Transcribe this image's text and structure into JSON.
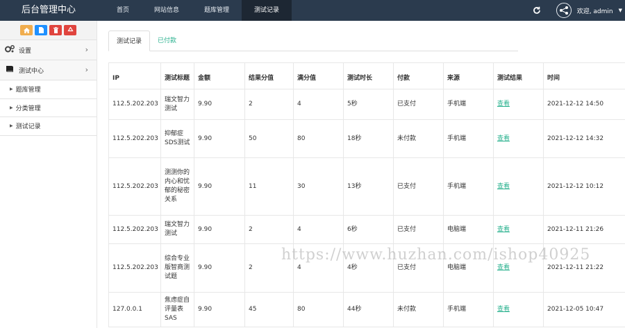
{
  "app": {
    "title": "后台管理中心"
  },
  "nav": [
    {
      "label": "首页",
      "active": false
    },
    {
      "label": "网站信息",
      "active": false
    },
    {
      "label": "题库管理",
      "active": false
    },
    {
      "label": "测试记录",
      "active": true
    }
  ],
  "user": {
    "welcome": "欢迎, admin"
  },
  "quick_buttons": [
    {
      "icon": "home-icon",
      "color": "#f0ad4e"
    },
    {
      "icon": "file-icon",
      "color": "#1e90ff"
    },
    {
      "icon": "trash-icon",
      "color": "#e0443e"
    },
    {
      "icon": "recycle-icon",
      "color": "#e0443e"
    }
  ],
  "sidebar": {
    "groups": [
      {
        "label": "设置",
        "icon": "gears-icon"
      },
      {
        "label": "测试中心",
        "icon": "book-icon"
      }
    ],
    "items": [
      {
        "label": "题库管理"
      },
      {
        "label": "分类管理"
      },
      {
        "label": "测试记录"
      }
    ]
  },
  "tabs": [
    {
      "label": "测试记录",
      "active": true
    },
    {
      "label": "已付款",
      "active": false
    }
  ],
  "table": {
    "headers": [
      "IP",
      "测试标题",
      "金额",
      "结果分值",
      "满分值",
      "测试时长",
      "付款",
      "来源",
      "测试结果",
      "时间"
    ],
    "rows": [
      {
        "ip": "112.5.202.203",
        "title": "瑞文智力测试",
        "amount": "9.90",
        "score": "2",
        "full": "4",
        "duration": "5秒",
        "pay": "已支付",
        "source": "手机端",
        "result": "查看",
        "time": "2021-12-12 14:50"
      },
      {
        "ip": "112.5.202.203",
        "title": "抑郁症SDS测试",
        "amount": "9.90",
        "score": "50",
        "full": "80",
        "duration": "18秒",
        "pay": "未付款",
        "source": "手机端",
        "result": "查看",
        "time": "2021-12-12 14:32"
      },
      {
        "ip": "112.5.202.203",
        "title": "测测你的内心和忧郁的秘密关系",
        "amount": "9.90",
        "score": "11",
        "full": "30",
        "duration": "13秒",
        "pay": "已支付",
        "source": "手机端",
        "result": "查看",
        "time": "2021-12-12 10:12"
      },
      {
        "ip": "112.5.202.203",
        "title": "瑞文智力测试",
        "amount": "9.90",
        "score": "2",
        "full": "4",
        "duration": "6秒",
        "pay": "已支付",
        "source": "电脑端",
        "result": "查看",
        "time": "2021-12-11 21:26"
      },
      {
        "ip": "112.5.202.203",
        "title": "综合专业版智商测试题",
        "amount": "9.90",
        "score": "2",
        "full": "4",
        "duration": "4秒",
        "pay": "已支付",
        "source": "电脑端",
        "result": "查看",
        "time": "2021-12-11 21:22"
      },
      {
        "ip": "127.0.0.1",
        "title": "焦虑症自评量表SAS",
        "amount": "9.90",
        "score": "45",
        "full": "80",
        "duration": "44秒",
        "pay": "未付款",
        "source": "手机端",
        "result": "查看",
        "time": "2021-12-05 10:47"
      }
    ]
  },
  "watermark": "https://www.huzhan.com/ishop40925"
}
